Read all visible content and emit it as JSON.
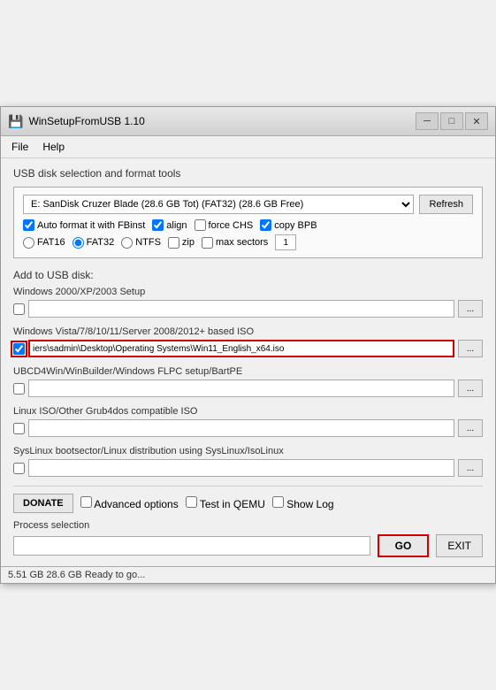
{
  "window": {
    "title": "WinSetupFromUSB 1.10",
    "icon": "💾"
  },
  "menu": {
    "items": [
      "File",
      "Help"
    ]
  },
  "usb_section": {
    "title": "USB disk selection and format tools",
    "drive_value": "E: SanDisk Cruzer Blade (28.6 GB Tot) (FAT32) (28.6 GB Free)",
    "refresh_label": "Refresh",
    "auto_format_label": "Auto format it with FBinst",
    "align_label": "align",
    "force_chs_label": "force CHS",
    "copy_bpb_label": "copy BPB",
    "fat16_label": "FAT16",
    "fat32_label": "FAT32",
    "ntfs_label": "NTFS",
    "zip_label": "zip",
    "max_sectors_label": "max sectors",
    "max_sectors_value": "1",
    "auto_format_checked": true,
    "align_checked": true,
    "force_chs_checked": false,
    "copy_bpb_checked": true,
    "fat32_selected": true,
    "zip_checked": false
  },
  "add_section": {
    "title": "Add to USB disk:",
    "items": [
      {
        "label": "Windows 2000/XP/2003 Setup",
        "checked": false,
        "value": "",
        "highlighted": false
      },
      {
        "label": "Windows Vista/7/8/10/11/Server 2008/2012+ based ISO",
        "checked": true,
        "value": "iers\\sadmin\\Desktop\\Operating Systems\\Win11_English_x64.iso",
        "highlighted": true
      },
      {
        "label": "UBCD4Win/WinBuilder/Windows FLPC setup/BartPE",
        "checked": false,
        "value": "",
        "highlighted": false
      },
      {
        "label": "Linux ISO/Other Grub4dos compatible ISO",
        "checked": false,
        "value": "",
        "highlighted": false
      },
      {
        "label": "SysLinux bootsector/Linux distribution using SysLinux/IsoLinux",
        "checked": false,
        "value": "",
        "highlighted": false
      }
    ]
  },
  "bottom": {
    "donate_label": "DONATE",
    "advanced_options_label": "Advanced options",
    "test_qemu_label": "Test in QEMU",
    "show_log_label": "Show Log",
    "process_label": "Process selection",
    "go_label": "GO",
    "exit_label": "EXIT"
  },
  "status_bar": {
    "text": "5.51 GB  28.6 GB  Ready to go..."
  }
}
